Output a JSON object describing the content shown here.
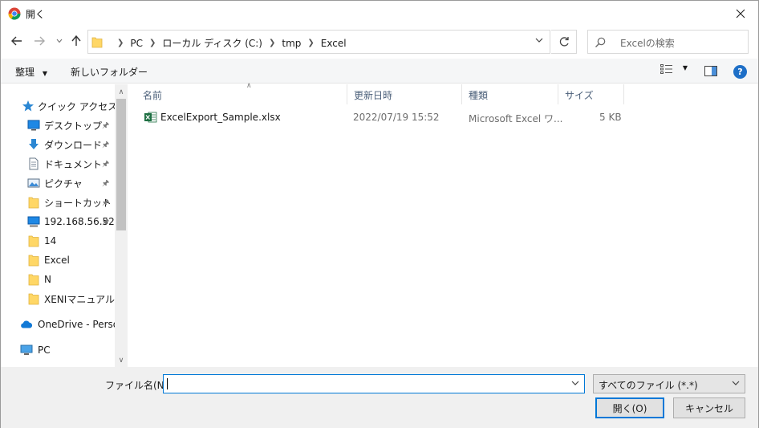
{
  "window": {
    "title": "開く"
  },
  "nav": {
    "back_icon": "arrow-left-icon",
    "forward_icon": "arrow-right-icon",
    "recent_icon": "chevron-down-icon",
    "up_icon": "arrow-up-icon"
  },
  "address": {
    "crumbs": [
      "PC",
      "ローカル ディスク (C:)",
      "tmp",
      "Excel"
    ]
  },
  "search": {
    "placeholder": "Excelの検索"
  },
  "toolbar": {
    "organize_label": "整理",
    "new_folder_label": "新しいフォルダー",
    "help_label": "?"
  },
  "navpane": {
    "items": [
      {
        "label": "クイック アクセス",
        "icon": "star-icon",
        "pinned": false
      },
      {
        "label": "デスクトップ",
        "icon": "desktop-icon",
        "pinned": true
      },
      {
        "label": "ダウンロード",
        "icon": "download-icon",
        "pinned": true
      },
      {
        "label": "ドキュメント",
        "icon": "document-icon",
        "pinned": true
      },
      {
        "label": "ピクチャ",
        "icon": "picture-icon",
        "pinned": true
      },
      {
        "label": "ショートカット",
        "icon": "folder-icon",
        "pinned": true
      },
      {
        "label": "192.168.56.52",
        "icon": "network-drive-icon",
        "pinned": true
      },
      {
        "label": "14",
        "icon": "folder-icon",
        "pinned": false
      },
      {
        "label": "Excel",
        "icon": "folder-icon",
        "pinned": false
      },
      {
        "label": "N",
        "icon": "folder-icon",
        "pinned": false
      },
      {
        "label": "XENIマニュアル用",
        "icon": "folder-icon",
        "pinned": false
      },
      {
        "label": "OneDrive - Person",
        "icon": "cloud-icon",
        "pinned": false
      },
      {
        "label": "PC",
        "icon": "computer-icon",
        "pinned": false
      }
    ]
  },
  "filelist": {
    "columns": [
      "名前",
      "更新日時",
      "種類",
      "サイズ"
    ],
    "rows": [
      {
        "name": "ExcelExport_Sample.xlsx",
        "modified": "2022/07/19 15:52",
        "type": "Microsoft Excel ワ...",
        "size": "5 KB"
      }
    ]
  },
  "bottom": {
    "filename_label": "ファイル名(N):",
    "filename_value": "",
    "filetype_value": "すべてのファイル (*.*)",
    "open_label": "開く(O)",
    "cancel_label": "キャンセル"
  },
  "colors": {
    "accent": "#0078d7",
    "folder": "#ffd766",
    "excel_green": "#1d6f42"
  }
}
